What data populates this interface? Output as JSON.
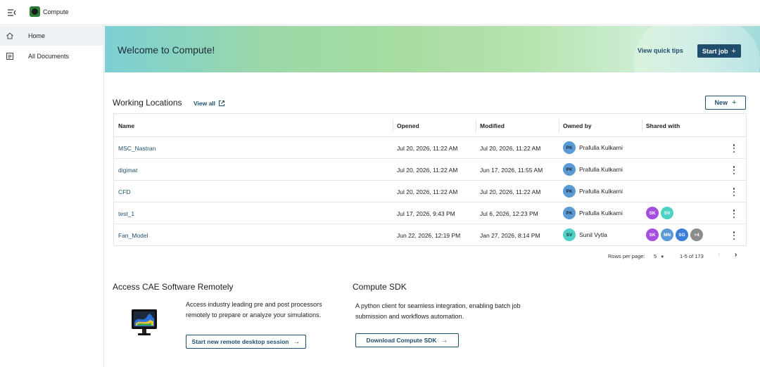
{
  "app": {
    "title": "Compute"
  },
  "sidebar": {
    "items": [
      {
        "label": "Home",
        "icon": "home-icon"
      },
      {
        "label": "All Documents",
        "icon": "document-icon"
      }
    ]
  },
  "banner": {
    "title": "Welcome to Compute!",
    "tips_label": "View quick tips",
    "start_job_label": "Start job"
  },
  "working_locations": {
    "title": "Working Locations",
    "view_all_label": "View all",
    "new_label": "New",
    "columns": [
      "Name",
      "Opened",
      "Modified",
      "Owned by",
      "Shared with"
    ],
    "rows": [
      {
        "name": "MSC_Nastran",
        "opened": "Jul 20, 2026, 11:22 AM",
        "modified": "Jul 20, 2026, 11:22 AM",
        "owner_initials": "PK",
        "owner": "Prafulla Kulkarni",
        "shared": []
      },
      {
        "name": "digimat",
        "opened": "Jul 20, 2026, 11:22 AM",
        "modified": "Jun 17, 2026, 11:55 AM",
        "owner_initials": "PK",
        "owner": "Prafulla Kulkarni",
        "shared": []
      },
      {
        "name": "CFD",
        "opened": "Jul 20, 2026, 11:22 AM",
        "modified": "Jul 20, 2026, 11:22 AM",
        "owner_initials": "PK",
        "owner": "Prafulla Kulkarni",
        "shared": []
      },
      {
        "name": "test_1",
        "opened": "Jul 17, 2026, 9:43 PM",
        "modified": "Jul 6, 2026, 12:23 PM",
        "owner_initials": "PK",
        "owner": "Prafulla Kulkarni",
        "shared": [
          {
            "initials": "SK",
            "color": "#a54fe0"
          },
          {
            "initials": "SV",
            "color": "#4fd1c5"
          }
        ]
      },
      {
        "name": "Fan_Model",
        "opened": "Jun 22, 2026, 12:19 PM",
        "modified": "Jan 27, 2026, 8:14 PM",
        "owner_initials": "SV",
        "owner": "Sunil Vytla",
        "shared": [
          {
            "initials": "SK",
            "color": "#a54fe0"
          },
          {
            "initials": "MN",
            "color": "#5b9bd5"
          },
          {
            "initials": "SG",
            "color": "#3b7dd8"
          },
          {
            "initials": "+4",
            "color": "#8c8c8c"
          }
        ]
      }
    ],
    "pagination": {
      "rows_per_page_label": "Rows per page:",
      "rows_per_page": "5",
      "range": "1-5 of 173"
    }
  },
  "remote_card": {
    "title": "Access CAE Software Remotely",
    "text": "Access industry leading pre and post processors remotely to prepare or analyze your simulations.",
    "button_label": "Start new remote desktop session"
  },
  "sdk_card": {
    "title": "Compute SDK",
    "text": "A python client for seamless integration, enabling batch job submission and workflows automation.",
    "button_label": "Download Compute SDK"
  },
  "colors": {
    "primary": "#1f4e6e",
    "owner_pk": "#5b9bd5",
    "owner_sv": "#4fd1c5"
  }
}
